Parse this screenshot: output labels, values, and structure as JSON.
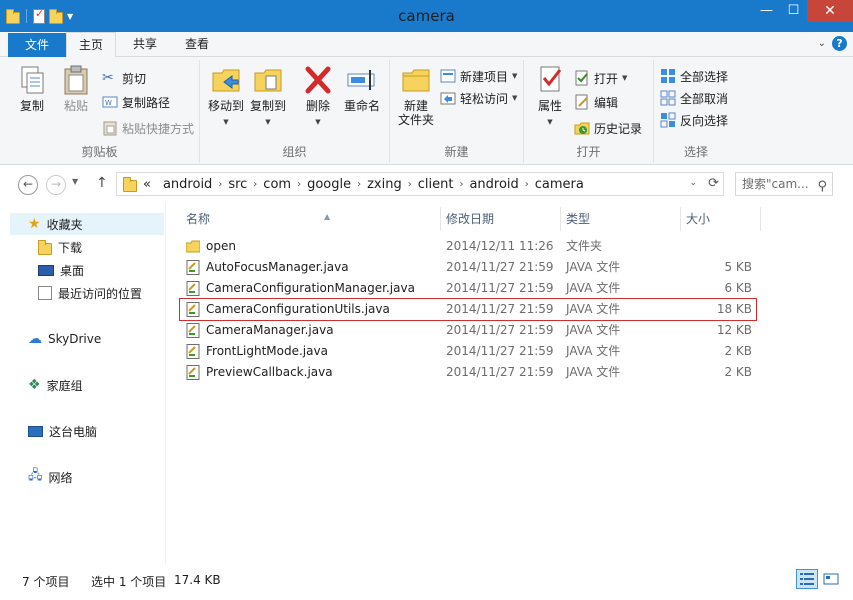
{
  "window": {
    "title": "camera"
  },
  "ribbon_tabs": [
    {
      "label": "文件"
    },
    {
      "label": "主页"
    },
    {
      "label": "共享"
    },
    {
      "label": "查看"
    }
  ],
  "ribbon": {
    "clipboard": {
      "copy": "复制",
      "paste": "粘贴",
      "cut": "剪切",
      "copy_path": "复制路径",
      "paste_shortcut": "粘贴快捷方式",
      "label": "剪贴板"
    },
    "organize": {
      "move_to": "移动到",
      "copy_to": "复制到",
      "delete": "删除",
      "rename": "重命名",
      "label": "组织"
    },
    "new": {
      "new_folder": "新建\n文件夹",
      "new_item": "新建项目",
      "easy_access": "轻松访问",
      "label": "新建"
    },
    "open": {
      "properties": "属性",
      "open": "打开",
      "edit": "编辑",
      "history": "历史记录",
      "label": "打开"
    },
    "select": {
      "select_all": "全部选择",
      "select_none": "全部取消",
      "invert": "反向选择",
      "label": "选择"
    }
  },
  "address": {
    "overflow": "«",
    "crumbs": [
      "android",
      "src",
      "com",
      "google",
      "zxing",
      "client",
      "android",
      "camera"
    ]
  },
  "search": {
    "placeholder": "搜索\"cam..."
  },
  "nav": {
    "favorites": "收藏夹",
    "downloads": "下载",
    "desktop": "桌面",
    "recent": "最近访问的位置",
    "skydrive": "SkyDrive",
    "homegroup": "家庭组",
    "this_pc": "这台电脑",
    "network": "网络"
  },
  "columns": {
    "name": "名称",
    "date": "修改日期",
    "type": "类型",
    "size": "大小"
  },
  "files": [
    {
      "name": "open",
      "date": "2014/12/11 11:26",
      "type": "文件夹",
      "size": "",
      "kind": "folder"
    },
    {
      "name": "AutoFocusManager.java",
      "date": "2014/11/27 21:59",
      "type": "JAVA 文件",
      "size": "5 KB",
      "kind": "java"
    },
    {
      "name": "CameraConfigurationManager.java",
      "date": "2014/11/27 21:59",
      "type": "JAVA 文件",
      "size": "6 KB",
      "kind": "java"
    },
    {
      "name": "CameraConfigurationUtils.java",
      "date": "2014/11/27 21:59",
      "type": "JAVA 文件",
      "size": "18 KB",
      "kind": "java",
      "highlighted": true
    },
    {
      "name": "CameraManager.java",
      "date": "2014/11/27 21:59",
      "type": "JAVA 文件",
      "size": "12 KB",
      "kind": "java"
    },
    {
      "name": "FrontLightMode.java",
      "date": "2014/11/27 21:59",
      "type": "JAVA 文件",
      "size": "2 KB",
      "kind": "java"
    },
    {
      "name": "PreviewCallback.java",
      "date": "2014/11/27 21:59",
      "type": "JAVA 文件",
      "size": "2 KB",
      "kind": "java"
    }
  ],
  "status": {
    "count": "7 个项目",
    "selected": "选中 1 个项目",
    "selected_size": "17.4 KB"
  },
  "colors": {
    "accent": "#1979ca",
    "highlight_border": "#d12f2f"
  }
}
